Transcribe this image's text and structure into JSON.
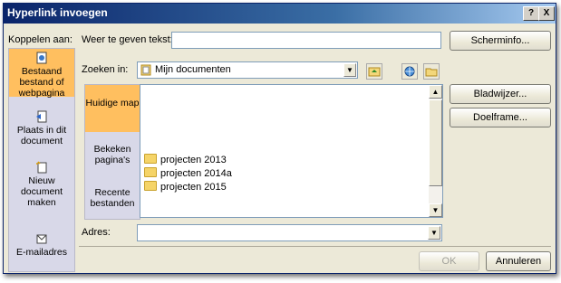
{
  "window": {
    "title": "Hyperlink invoegen",
    "help_btn": "?",
    "close_btn": "X"
  },
  "link_to": {
    "label": "Koppelen aan:",
    "items": [
      {
        "label": "Bestaand bestand of webpagina",
        "icon": "existing-file-icon"
      },
      {
        "label": "Plaats in dit document",
        "icon": "place-in-document-icon"
      },
      {
        "label": "Nieuw document maken",
        "icon": "new-document-icon"
      },
      {
        "label": "E-mailadres",
        "icon": "email-address-icon"
      }
    ],
    "selected_index": 0
  },
  "display_text": {
    "label": "Weer te geven tekst:",
    "value": ""
  },
  "screentip_button": "Scherminfo...",
  "look_in": {
    "label": "Zoeken in:",
    "value": "Mijn documenten"
  },
  "places": [
    {
      "label": "Huidige map"
    },
    {
      "label": "Bekeken pagina's"
    },
    {
      "label": "Recente bestanden"
    }
  ],
  "files": [
    "projecten 2013",
    "projecten 2014a",
    "projecten 2015"
  ],
  "bookmark_button": "Bladwijzer...",
  "target_frame_button": "Doelframe...",
  "address": {
    "label": "Adres:",
    "value": ""
  },
  "ok_button": "OK",
  "cancel_button": "Annuleren",
  "colors": {
    "title_bar": "#0a246a",
    "selected_place": "#ffbf5f",
    "pane_bg": "#d8d8e8",
    "dialog_bg": "#ece9d8"
  }
}
